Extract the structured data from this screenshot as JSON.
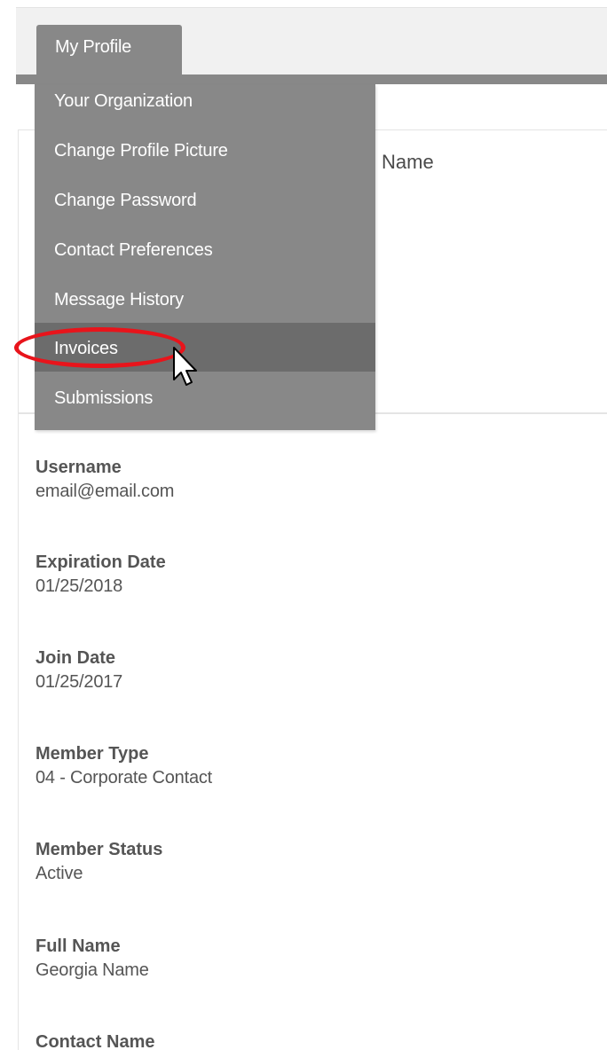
{
  "nav": {
    "tab_label": "My Profile"
  },
  "dropdown": {
    "items": [
      {
        "label": "Your Organization"
      },
      {
        "label": "Change Profile Picture"
      },
      {
        "label": "Change Password"
      },
      {
        "label": "Contact Preferences"
      },
      {
        "label": "Message History"
      },
      {
        "label": "Invoices"
      },
      {
        "label": "Submissions"
      }
    ],
    "hovered_item": "Invoices"
  },
  "profile_card": {
    "partial_heading": "Name"
  },
  "profile": {
    "fields": [
      {
        "label": "Username",
        "value": "email@email.com"
      },
      {
        "label": "Expiration Date",
        "value": "01/25/2018"
      },
      {
        "label": "Join Date",
        "value": "01/25/2017"
      },
      {
        "label": "Member Type",
        "value": "04 - Corporate Contact"
      },
      {
        "label": "Member Status",
        "value": "Active"
      },
      {
        "label": "Full Name",
        "value": "Georgia Name"
      },
      {
        "label": "Contact Name",
        "value": ""
      }
    ]
  },
  "colors": {
    "menu_background": "#888888",
    "menu_hover": "#6c6c6c",
    "annotation_ring": "#e8141b",
    "label_text": "#555555"
  }
}
